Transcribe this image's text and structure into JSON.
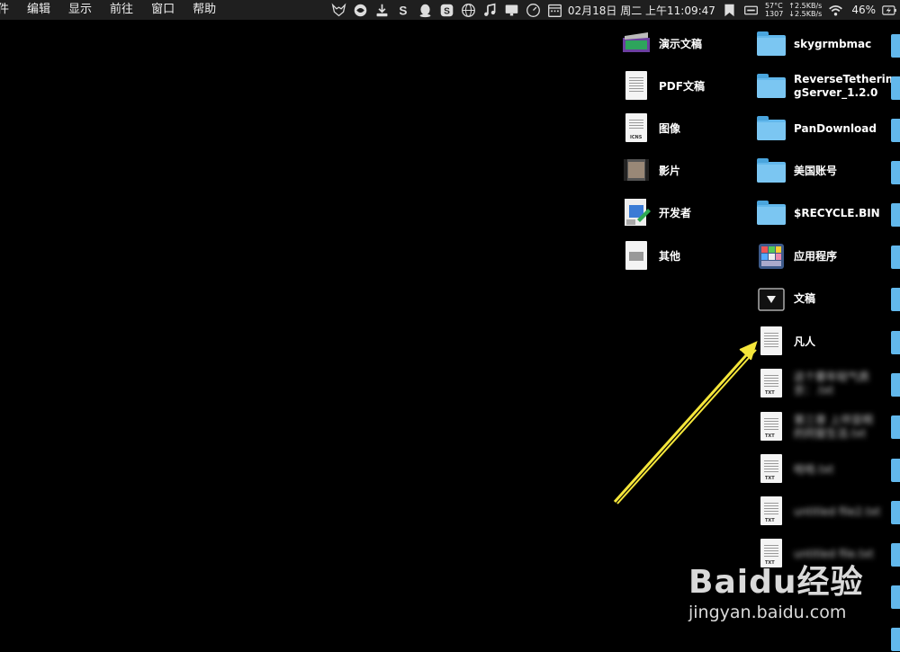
{
  "menubar": {
    "items": [
      "件",
      "编辑",
      "显示",
      "前往",
      "窗口",
      "帮助"
    ],
    "tray_icons": [
      "fox-icon",
      "swirl-icon",
      "download-icon",
      "s-icon",
      "qq-icon",
      "sogou-icon",
      "globe-icon",
      "music-note-icon",
      "monitor-icon",
      "clock-app-icon",
      "calendar-icon"
    ],
    "clock": "02月18日 周二 上午11:09:47",
    "temp": "57°C",
    "rpm": "1307",
    "upload": "↑2.5KB/s",
    "download": "↓2.5KB/s",
    "battery_percent": "46%"
  },
  "desktop": {
    "left_column": [
      {
        "label": "演示文稿",
        "icon": "presentation-icon"
      },
      {
        "label": "PDF文稿",
        "icon": "pdf-document-icon"
      },
      {
        "label": "图像",
        "icon": "image-file-icon"
      },
      {
        "label": "影片",
        "icon": "movie-icon"
      },
      {
        "label": "开发者",
        "icon": "developer-icon"
      },
      {
        "label": "其他",
        "icon": "other-file-icon"
      }
    ],
    "right_column": [
      {
        "label": "skygrmbmac",
        "icon": "folder-icon"
      },
      {
        "label": "ReverseTethering Server_1.2.0",
        "line1": "ReverseTetherin",
        "line2": "gServer_1.2.0",
        "icon": "folder-icon"
      },
      {
        "label": "PanDownload",
        "icon": "folder-icon"
      },
      {
        "label": "美国账号",
        "icon": "folder-icon"
      },
      {
        "label": "$RECYCLE.BIN",
        "icon": "folder-icon"
      },
      {
        "label": "应用程序",
        "icon": "applications-icon"
      },
      {
        "label": "文稿",
        "icon": "documents-stack-icon"
      },
      {
        "label": "凡人",
        "icon": "text-document-icon"
      }
    ],
    "blurred_files": [
      {
        "line1": "这个要年轻气质",
        "line2": "京：.txt",
        "tag": "TXT"
      },
      {
        "line1": "第三章 上坪显明",
        "line2": "的同窗生活.txt",
        "tag": "TXT"
      },
      {
        "line1": "哈哈.txt",
        "line2": "",
        "tag": "TXT"
      },
      {
        "line1": "untitled file2.txt",
        "line2": "",
        "tag": "TXT"
      },
      {
        "line1": "untitled file.txt",
        "line2": "",
        "tag": "TXT"
      }
    ]
  },
  "watermark": {
    "logo": "Baidu经验",
    "url": "jingyan.baidu.com"
  },
  "colors": {
    "background": "#000000",
    "menubar": "#1f1f1f",
    "folder": "#62b8ec",
    "arrow": "#f5e63a"
  }
}
